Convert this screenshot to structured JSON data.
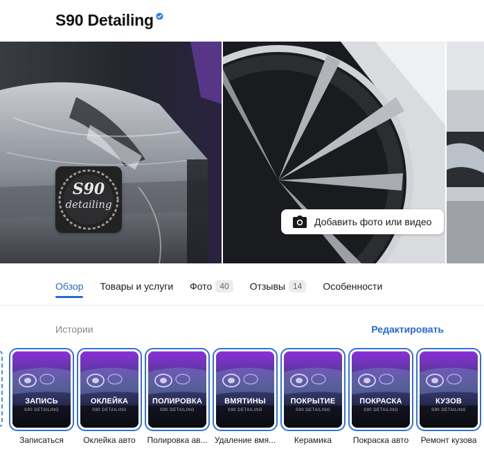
{
  "header": {
    "title": "S90 Detailing"
  },
  "gallery": {
    "logo_top": "S90",
    "logo_bottom": "detailing",
    "add_button_label": "Добавить фото или видео"
  },
  "tabs": [
    {
      "label": "Обзор",
      "count": null
    },
    {
      "label": "Товары и услуги",
      "count": null
    },
    {
      "label": "Фото",
      "count": "40"
    },
    {
      "label": "Отзывы",
      "count": "14"
    },
    {
      "label": "Особенности",
      "count": null
    }
  ],
  "stories": {
    "label": "Истории",
    "edit_label": "Редактировать",
    "brand_sub": "S90 DETAILING",
    "items": [
      {
        "word": "ЗАПИСЬ",
        "caption": "Записаться"
      },
      {
        "word": "ОКЛЕЙКА",
        "caption": "Оклейка авто"
      },
      {
        "word": "ПОЛИРОВКА",
        "caption": "Полировка ав..."
      },
      {
        "word": "ВМЯТИНЫ",
        "caption": "Удаление вмя..."
      },
      {
        "word": "ПОКРЫТИЕ",
        "caption": "Керамика"
      },
      {
        "word": "ПОКРАСКА",
        "caption": "Покраска авто"
      },
      {
        "word": "КУЗОВ",
        "caption": "Ремонт кузова"
      }
    ]
  },
  "colors": {
    "accent": "#2668d4",
    "story_border": "#2f6fe0",
    "verified": "#2f7ef6"
  }
}
